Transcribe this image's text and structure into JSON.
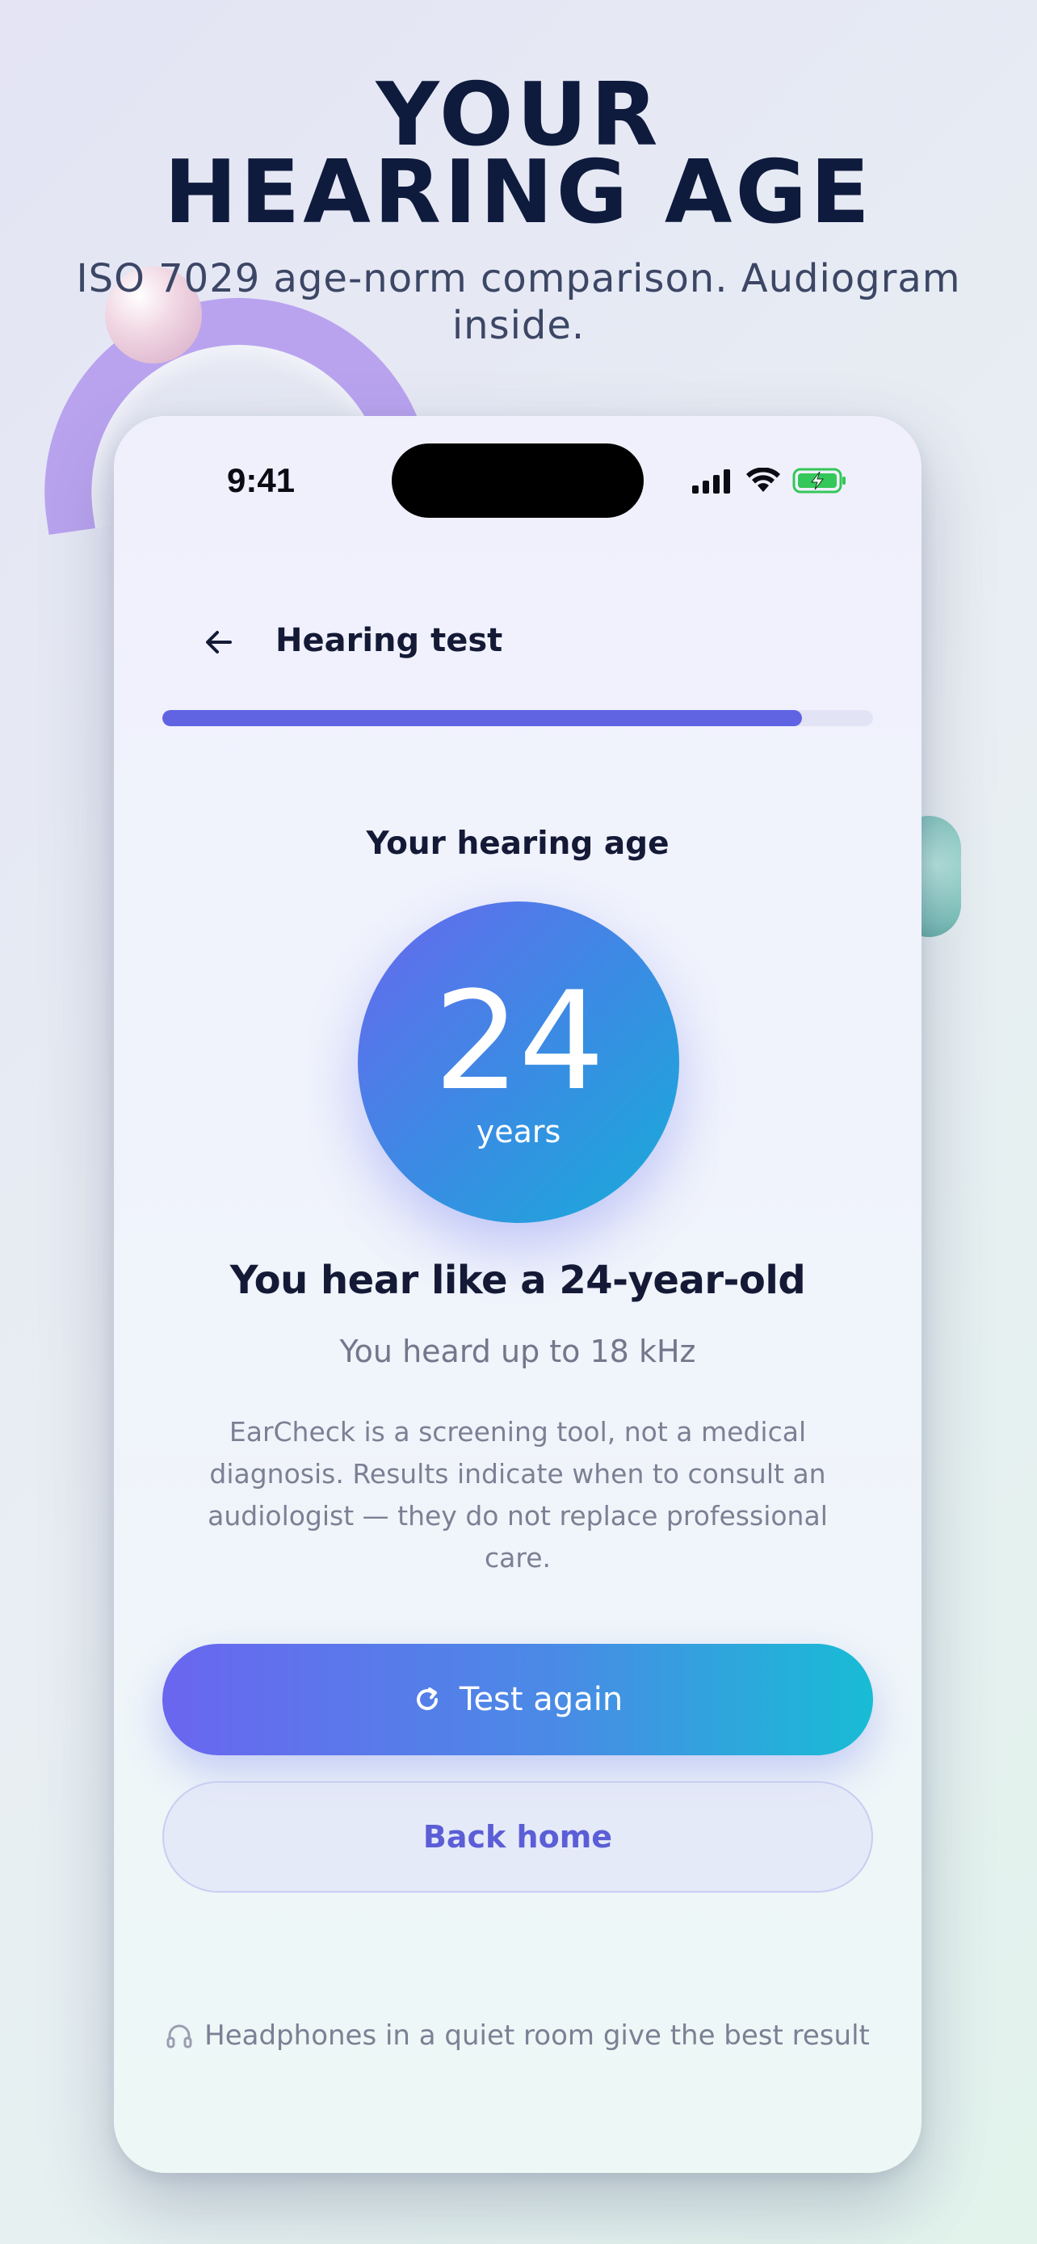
{
  "hero": {
    "title_line1": "YOUR",
    "title_line2": "HEARING AGE",
    "subtitle": "ISO 7029 age-norm comparison. Audiogram inside."
  },
  "status_bar": {
    "time": "9:41",
    "icons": [
      "signal-icon",
      "wifi-icon",
      "battery-charging-icon"
    ],
    "battery_color": "#34c759"
  },
  "nav": {
    "back_icon": "arrow-left-icon",
    "title": "Hearing test"
  },
  "progress": {
    "fraction": 0.9
  },
  "result": {
    "section_label": "Your hearing age",
    "age_value": "24",
    "age_unit": "years",
    "headline": "You hear like a 24-year-old",
    "detail": "You heard up to 18 kHz",
    "disclaimer": "EarCheck is a screening tool, not a medical diagnosis. Results indicate when to consult an audiologist — they do not replace professional care."
  },
  "actions": {
    "primary_icon": "refresh-icon",
    "primary_label": "Test again",
    "secondary_label": "Back home"
  },
  "tip": {
    "icon": "headphones-icon",
    "text": "Headphones in a quiet room give the best result"
  },
  "colors": {
    "accent": "#6064e3",
    "text_dark": "#141a36",
    "gradient_start": "#6a66ef",
    "gradient_end": "#18bcd5"
  }
}
